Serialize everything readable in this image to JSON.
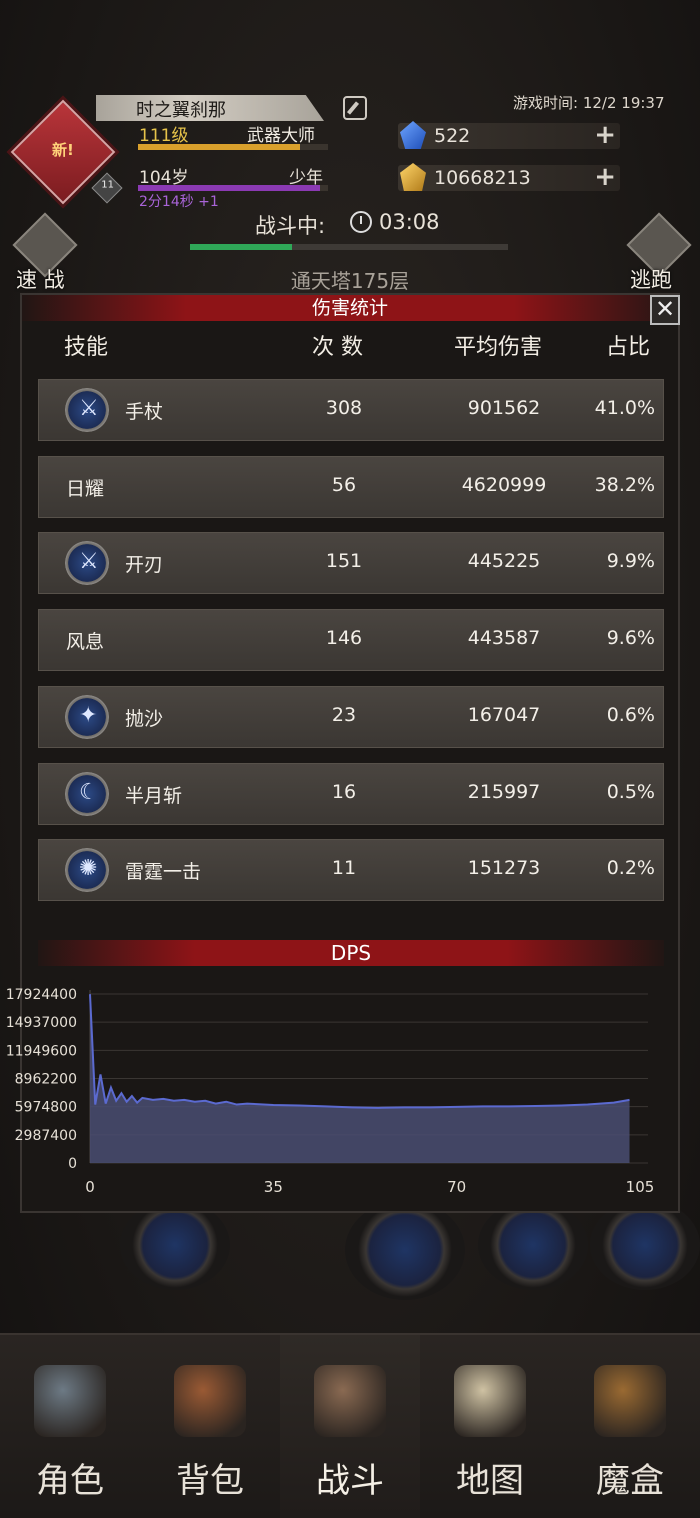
{
  "player": {
    "name": "时之翼刹那",
    "new_badge": "新!",
    "avatar_level": "11",
    "level": "111级",
    "title": "武器大师",
    "age": "104岁",
    "age_stage": "少年",
    "time_plus": "2分14秒 +1",
    "xp_progress": 0.85,
    "age_progress": 0.96
  },
  "game_time": "游戏时间: 12/2 19:37",
  "resources": {
    "gems": "522",
    "gold": "10668213"
  },
  "battle": {
    "status": "战斗中:",
    "timer": "03:08",
    "progress": 0.32,
    "quick_battle": "速 战",
    "escape": "逃跑",
    "tower": "通天塔175层"
  },
  "damage_panel": {
    "title": "伤害统计",
    "close": "✕",
    "headers": {
      "skill": "技能",
      "count": "次 数",
      "avg": "平均伤害",
      "share": "占比"
    },
    "rows": [
      {
        "name": "手杖",
        "count": "308",
        "avg": "901562",
        "share": "41.0%",
        "icon": "sword-skill-icon"
      },
      {
        "name": "日耀",
        "count": "56",
        "avg": "4620999",
        "share": "38.2%",
        "icon": ""
      },
      {
        "name": "开刃",
        "count": "151",
        "avg": "445225",
        "share": "9.9%",
        "icon": "sword-skill-icon"
      },
      {
        "name": "风息",
        "count": "146",
        "avg": "443587",
        "share": "9.6%",
        "icon": ""
      },
      {
        "name": "抛沙",
        "count": "23",
        "avg": "167047",
        "share": "0.6%",
        "icon": "sand-skill-icon"
      },
      {
        "name": "半月斩",
        "count": "16",
        "avg": "215997",
        "share": "0.5%",
        "icon": "crescent-skill-icon"
      },
      {
        "name": "雷霆一击",
        "count": "11",
        "avg": "151273",
        "share": "0.2%",
        "icon": "thunder-skill-icon"
      }
    ]
  },
  "chart_data": {
    "type": "area",
    "title": "DPS",
    "xlabel": "",
    "ylabel": "",
    "x_ticks": [
      "0",
      "35",
      "70",
      "105"
    ],
    "y_ticks": [
      "17924400",
      "14937000",
      "11949600",
      "8962200",
      "5974800",
      "2987400",
      "0"
    ],
    "xlim": [
      0,
      105
    ],
    "ylim": [
      0,
      17924400
    ],
    "grid": true,
    "series": [
      {
        "color": "#5b6ad0",
        "x": [
          0,
          1,
          2,
          3,
          4,
          5,
          6,
          7,
          8,
          9,
          10,
          12,
          14,
          16,
          18,
          20,
          22,
          24,
          26,
          28,
          30,
          35,
          40,
          45,
          50,
          55,
          60,
          65,
          70,
          75,
          80,
          85,
          90,
          95,
          100,
          103
        ],
        "y": [
          17900000,
          6200000,
          9400000,
          6300000,
          8000000,
          6600000,
          7400000,
          6500000,
          7100000,
          6400000,
          6900000,
          6700000,
          6800000,
          6600000,
          6700000,
          6500000,
          6600000,
          6300000,
          6500000,
          6200000,
          6300000,
          6150000,
          6100000,
          6000000,
          5900000,
          5850000,
          5900000,
          5900000,
          5950000,
          6000000,
          6000000,
          6050000,
          6100000,
          6200000,
          6400000,
          6700000
        ]
      }
    ]
  },
  "nav": [
    {
      "label": "角色",
      "art": "helmet",
      "color": "#6d7a85"
    },
    {
      "label": "背包",
      "art": "backpack",
      "color": "#9a5a34"
    },
    {
      "label": "战斗",
      "art": "sword-shield",
      "color": "#8a6a52"
    },
    {
      "label": "地图",
      "art": "scroll-map",
      "color": "#cfc2a3"
    },
    {
      "label": "魔盒",
      "art": "magic-box",
      "color": "#9a6a32"
    }
  ]
}
